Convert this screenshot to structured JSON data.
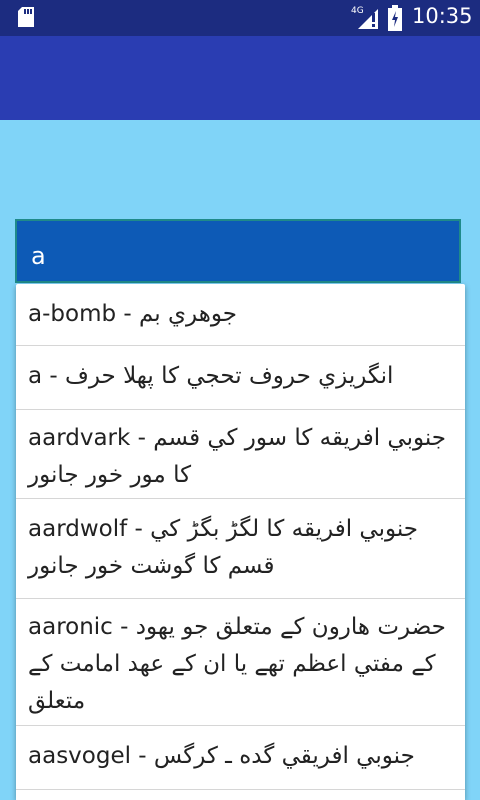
{
  "status_bar": {
    "network": "4G",
    "time": "10:35",
    "icons": [
      "sd-card-icon",
      "signal-icon",
      "battery-charging-icon"
    ]
  },
  "search": {
    "query": "a"
  },
  "suggestions": [
    {
      "text": "a-bomb - جوهري بم"
    },
    {
      "text": "a - انگريزي حروف تحجي کا پهلا حرف"
    },
    {
      "text": "aardvark - جنوبي افريقه کا سور کي قسم کا مور خور جانور"
    },
    {
      "text": "aardwolf - جنوبي افريقه کا لگڑ بگڑ کي قسم کا گوشت خور جانور"
    },
    {
      "text": "aaronic - حضرت هارون کے متعلق جو يهود کے مفتي اعظم تهے يا ان کے عهد امامت کے متعلق"
    },
    {
      "text": "aasvogel - جنوبي افريقي گده ـ کرگس"
    },
    {
      "text": ""
    }
  ],
  "colors": {
    "status_bar": "#1c2c80",
    "app_bar": "#2a3db2",
    "background": "#80d4f8",
    "search_box": "#0d5ab6"
  }
}
